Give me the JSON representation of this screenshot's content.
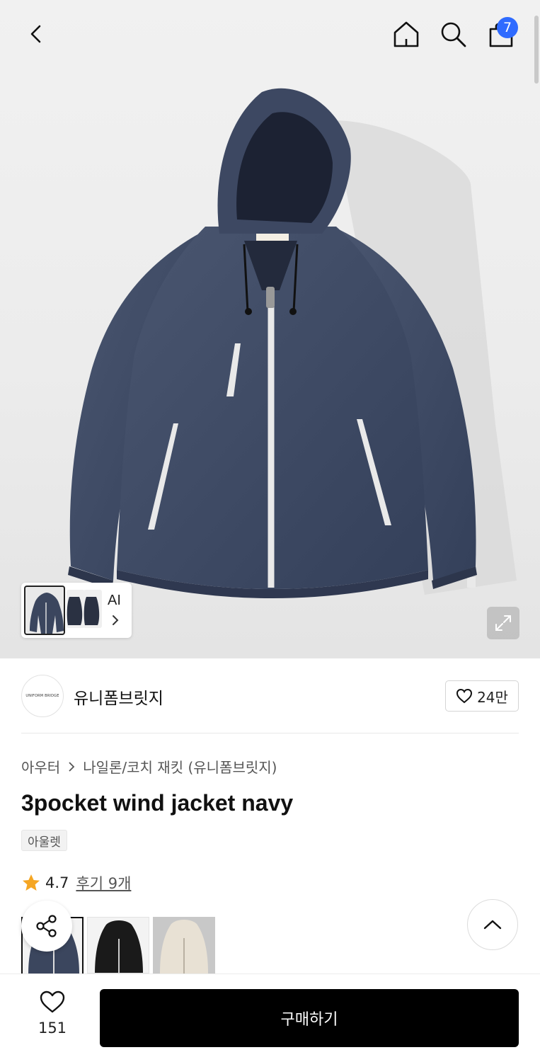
{
  "header": {
    "back_icon": "chevron-left-icon",
    "home_icon": "home-icon",
    "search_icon": "search-icon",
    "cart_icon": "shopping-bag-icon",
    "cart_count": "7",
    "badge_color": "#2f6bff"
  },
  "gallery": {
    "ai_label": "AI",
    "expand_icon": "expand-icon"
  },
  "brand": {
    "logo_text": "UNIFORM BRIDGE",
    "name": "유니폼브릿지",
    "like_count": "24만"
  },
  "breadcrumb": {
    "category": "아우터",
    "subcategory": "나일론/코치 재킷 (유니폼브릿지)"
  },
  "product": {
    "title": "3pocket wind jacket navy",
    "tag": "아울렛",
    "rating": "4.7",
    "review_link": "후기 9개",
    "star_color": "#f5a623",
    "colors": [
      "navy",
      "black",
      "beige"
    ]
  },
  "fab": {
    "share_icon": "share-icon",
    "top_icon": "chevron-up-icon"
  },
  "bottom_bar": {
    "wish_count": "151",
    "buy_label": "구매하기"
  }
}
